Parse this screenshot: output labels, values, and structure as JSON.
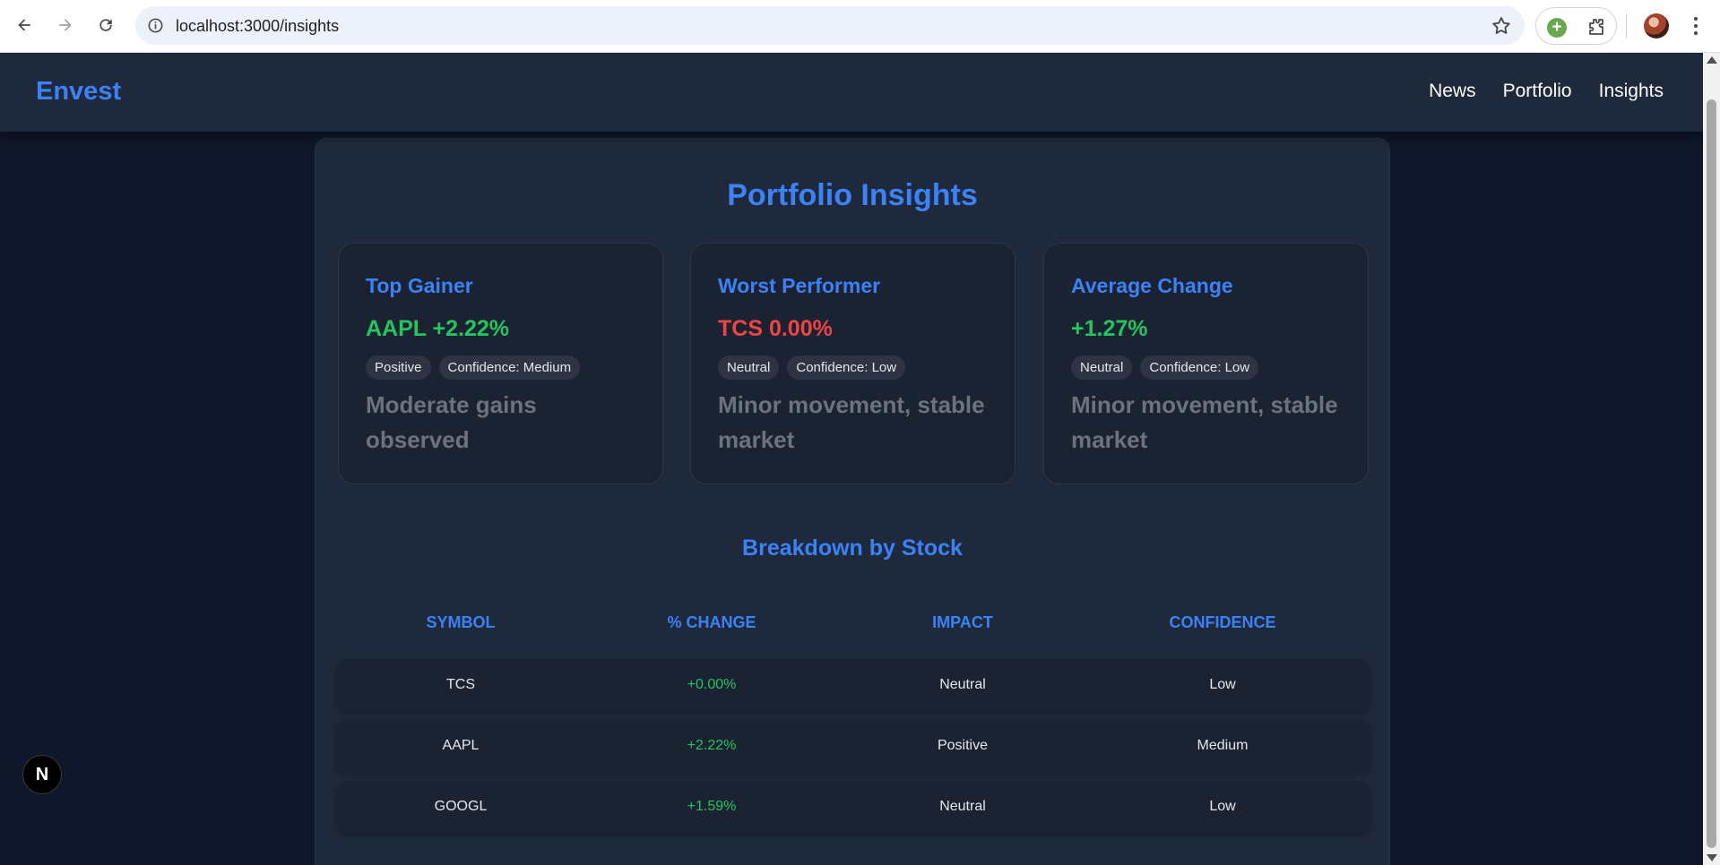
{
  "browser": {
    "url": "localhost:3000/insights",
    "icons": [
      "back-icon",
      "forward-icon",
      "reload-icon",
      "info-icon",
      "star-icon",
      "extension-add-icon",
      "puzzle-icon",
      "profile-avatar",
      "more-vert-icon"
    ]
  },
  "app": {
    "brand": "Envest",
    "nav": [
      "News",
      "Portfolio",
      "Insights"
    ]
  },
  "page": {
    "title": "Portfolio Insights",
    "cards": [
      {
        "title": "Top Gainer",
        "value": "AAPL +2.22%",
        "tone": "positive",
        "impact": "Positive",
        "confidence": "Confidence: Medium",
        "description": "Moderate gains observed"
      },
      {
        "title": "Worst Performer",
        "value": "TCS 0.00%",
        "tone": "negative",
        "impact": "Neutral",
        "confidence": "Confidence: Low",
        "description": "Minor movement, stable market"
      },
      {
        "title": "Average Change",
        "value": "+1.27%",
        "tone": "positive",
        "impact": "Neutral",
        "confidence": "Confidence: Low",
        "description": "Minor movement, stable market"
      }
    ],
    "breakdown": {
      "title": "Breakdown by Stock",
      "headers": [
        "SYMBOL",
        "% CHANGE",
        "IMPACT",
        "CONFIDENCE"
      ],
      "rows": [
        {
          "symbol": "TCS",
          "change": "+0.00%",
          "impact": "Neutral",
          "confidence": "Low"
        },
        {
          "symbol": "AAPL",
          "change": "+2.22%",
          "impact": "Positive",
          "confidence": "Medium"
        },
        {
          "symbol": "GOOGL",
          "change": "+1.59%",
          "impact": "Neutral",
          "confidence": "Low"
        }
      ]
    }
  },
  "dev_badge": "N",
  "colors": {
    "accent": "#3b82f6",
    "positive": "#22c55e",
    "negative": "#ef4444",
    "background": "#0f172a",
    "surface": "#1e293b"
  }
}
